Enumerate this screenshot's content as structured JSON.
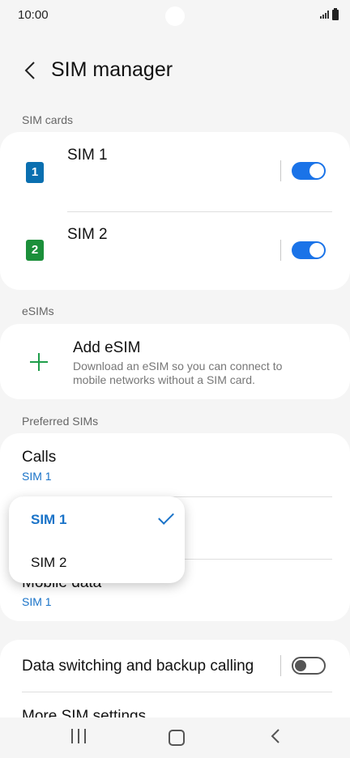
{
  "status": {
    "time": "10:00"
  },
  "header": {
    "title": "SIM manager"
  },
  "sim_cards": {
    "label": "SIM cards",
    "items": [
      {
        "name": "SIM 1",
        "badge": "1",
        "badge_color": "#0a6fb0",
        "enabled": true
      },
      {
        "name": "SIM 2",
        "badge": "2",
        "badge_color": "#1b8f3a",
        "enabled": true
      }
    ]
  },
  "esims": {
    "label": "eSIMs",
    "add_title": "Add eSIM",
    "add_desc": "Download an eSIM so you can connect to mobile networks without a SIM card."
  },
  "preferred": {
    "label": "Preferred SIMs",
    "calls": {
      "title": "Calls",
      "value": "SIM 1"
    },
    "mobile_data": {
      "title": "Mobile data",
      "value": "SIM 1"
    }
  },
  "popup": {
    "options": [
      "SIM 1",
      "SIM 2"
    ],
    "selected": "SIM 1"
  },
  "more": {
    "data_switching": {
      "title": "Data switching and backup calling",
      "enabled": false
    },
    "more_settings": "More SIM settings"
  },
  "colors": {
    "accent": "#1a73e8",
    "link": "#1a73c8",
    "background": "#f5f5f5"
  }
}
